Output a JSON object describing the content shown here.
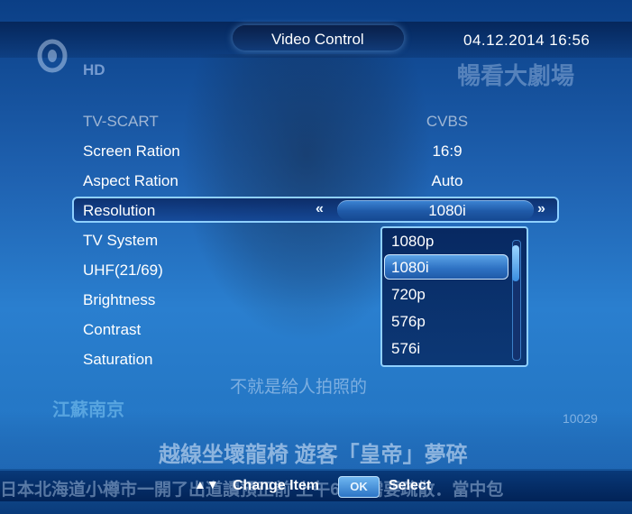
{
  "header": {
    "title": "Video Control",
    "datetime": "04.12.2014  16:56",
    "channel_badge": "HD"
  },
  "menu": {
    "rows": [
      {
        "label": "TV-SCART",
        "value": "CVBS",
        "disabled": true
      },
      {
        "label": "Screen Ration",
        "value": "16:9"
      },
      {
        "label": "Aspect Ration",
        "value": "Auto"
      },
      {
        "label": "Resolution",
        "value": "1080i",
        "selected": true
      },
      {
        "label": "TV System"
      },
      {
        "label": "UHF(21/69)"
      },
      {
        "label": "Brightness"
      },
      {
        "label": "Contrast"
      },
      {
        "label": "Saturation"
      }
    ]
  },
  "resolution_dropdown": {
    "options": [
      "1080p",
      "1080i",
      "720p",
      "576p",
      "576i"
    ],
    "selected": "1080i"
  },
  "background_video": {
    "subtitle": "不就是給人拍照的",
    "headline": "越線坐壞龍椅 遊客「皇帝」夢碎",
    "logo_text": "江蘇南京",
    "ticker": "日本北海道小樽市一開了出道讀預正前 上午60人需要疏散．當中包",
    "counter": "10029",
    "top_right": "暢看大劇場"
  },
  "help_bar": {
    "nav_arrows": "▲▼",
    "change_item": "Change Item",
    "ok_key": "OK",
    "select": "Select"
  },
  "colors": {
    "accent_border": "#8fd0ff",
    "highlight": "#2f73c4"
  }
}
